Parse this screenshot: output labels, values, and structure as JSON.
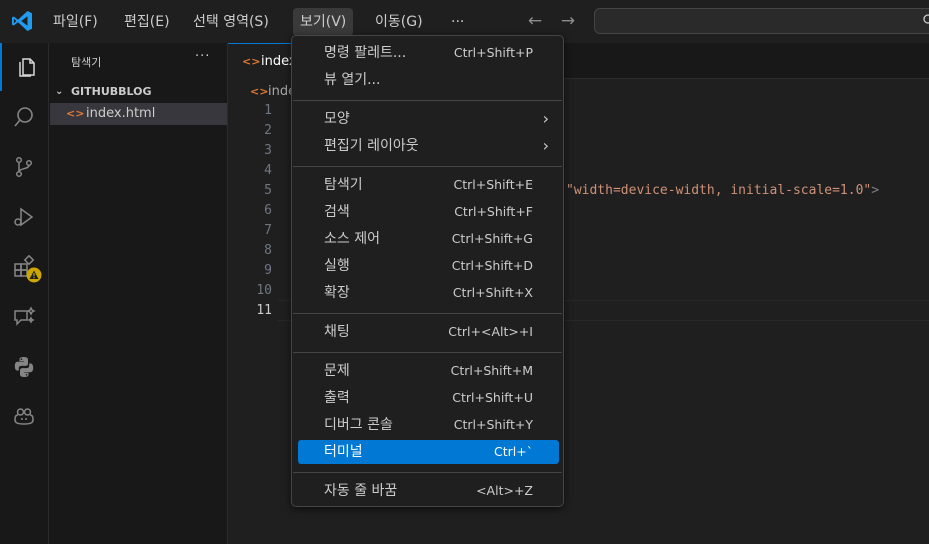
{
  "menubar": {
    "items": [
      "파일(F)",
      "편집(E)",
      "선택 영역(S)",
      "보기(V)",
      "이동(G)"
    ],
    "more": "···",
    "active_index": 3
  },
  "sidebar": {
    "title": "탐색기",
    "more": "···",
    "section": "GITHUBBLOG",
    "files": [
      "index.html"
    ]
  },
  "editor": {
    "tab_label": "index",
    "breadcrumb": "inde",
    "line_numbers": [
      "1",
      "2",
      "3",
      "4",
      "5",
      "6",
      "7",
      "8",
      "9",
      "10",
      "11"
    ],
    "current_line": "11",
    "code_fragment_string": "\"width=device-width, initial-scale=1.0\"",
    "code_fragment_end": ">"
  },
  "view_menu": {
    "groups": [
      [
        {
          "label": "명령 팔레트...",
          "shortcut": "Ctrl+Shift+P"
        },
        {
          "label": "뷰 열기...",
          "shortcut": ""
        }
      ],
      [
        {
          "label": "모양",
          "shortcut": "",
          "submenu": true
        },
        {
          "label": "편집기 레이아웃",
          "shortcut": "",
          "submenu": true
        }
      ],
      [
        {
          "label": "탐색기",
          "shortcut": "Ctrl+Shift+E"
        },
        {
          "label": "검색",
          "shortcut": "Ctrl+Shift+F"
        },
        {
          "label": "소스 제어",
          "shortcut": "Ctrl+Shift+G"
        },
        {
          "label": "실행",
          "shortcut": "Ctrl+Shift+D"
        },
        {
          "label": "확장",
          "shortcut": "Ctrl+Shift+X"
        }
      ],
      [
        {
          "label": "채팅",
          "shortcut": "Ctrl+<Alt>+I"
        }
      ],
      [
        {
          "label": "문제",
          "shortcut": "Ctrl+Shift+M"
        },
        {
          "label": "출력",
          "shortcut": "Ctrl+Shift+U"
        },
        {
          "label": "디버그 콘솔",
          "shortcut": "Ctrl+Shift+Y"
        },
        {
          "label": "터미널",
          "shortcut": "Ctrl+`",
          "highlighted": true
        }
      ],
      [
        {
          "label": "자동 줄 바꿈",
          "shortcut": "<Alt>+Z"
        }
      ]
    ]
  },
  "colors": {
    "accent": "#0078d4",
    "background": "#1f1f1f",
    "sidebar_bg": "#181818",
    "html_icon": "#e37933",
    "warning_badge": "#cca700"
  },
  "icons": {
    "activity_bar": [
      "explorer-icon",
      "search-icon",
      "source-control-icon",
      "run-debug-icon",
      "extensions-icon",
      "chat-icon",
      "python-icon",
      "copilot-icon"
    ]
  }
}
